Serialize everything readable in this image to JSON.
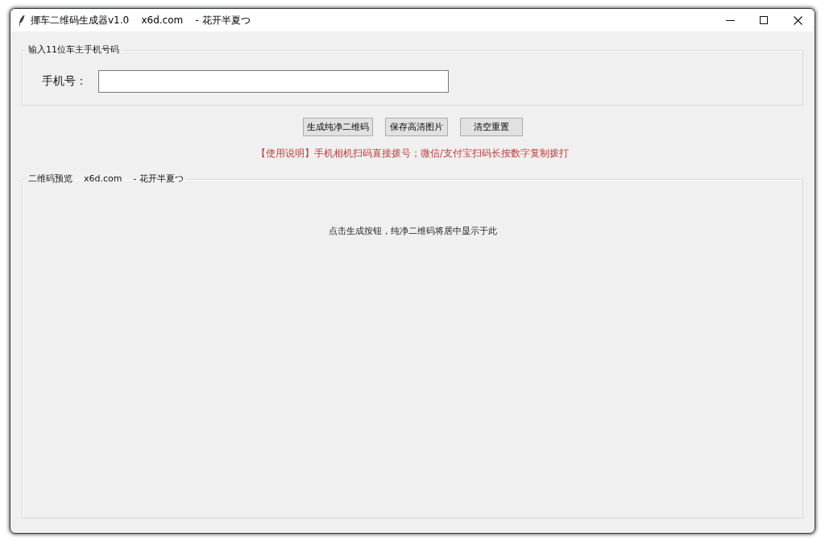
{
  "window": {
    "title": "挪车二维码生成器v1.0    x6d.com    - 花开半夏つ"
  },
  "input_group": {
    "title": "输入11位车主手机号码",
    "phone_field": {
      "label": "手机号："
    }
  },
  "buttons": [
    {
      "label": "生成纯净二维码"
    },
    {
      "label": "保存高清图片"
    },
    {
      "label": "清空重置"
    }
  ],
  "usage_note": "【使用说明】手机相机扫码直接拨号；微信/支付宝扫码长按数字复制拨打",
  "preview_group": {
    "title": "二维码预览    x6d.com    - 花开半夏つ",
    "message": "点击生成按钮，纯净二维码将居中显示于此"
  }
}
